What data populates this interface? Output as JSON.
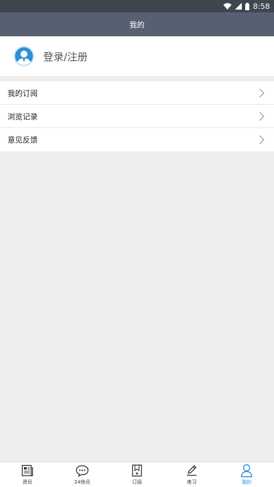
{
  "status_bar": {
    "time": "8:58"
  },
  "header": {
    "title": "我的"
  },
  "login": {
    "label": "登录/注册"
  },
  "menu": [
    {
      "label": "我的订阅"
    },
    {
      "label": "浏览记录"
    },
    {
      "label": "意见反馈"
    }
  ],
  "tabs": [
    {
      "label": "资讯",
      "icon": "newspaper-icon"
    },
    {
      "label": "24快讯",
      "icon": "chat-bubble-icon"
    },
    {
      "label": "订阅",
      "icon": "bookmark-icon"
    },
    {
      "label": "练习",
      "icon": "pencil-icon"
    },
    {
      "label": "我的",
      "icon": "person-icon",
      "active": true
    }
  ],
  "colors": {
    "accent": "#2f8fd8",
    "header": "#566070",
    "status_bar": "#3f4650"
  }
}
